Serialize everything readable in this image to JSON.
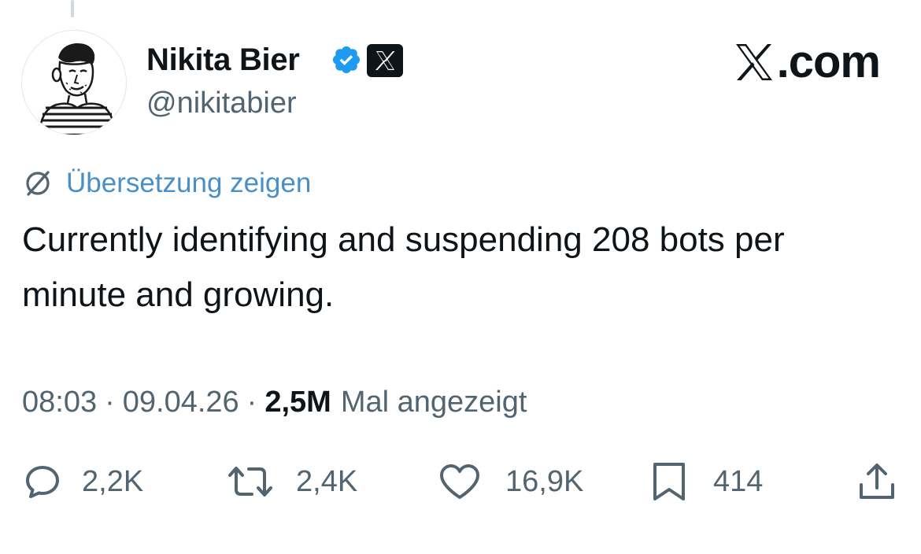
{
  "author": {
    "display_name": "Nikita Bier",
    "handle": "@nikitabier",
    "verified_icon": "verified-badge-icon",
    "affiliation_icon": "x-logo-icon"
  },
  "brand": {
    "text": ".com",
    "icon": "x-logo-icon"
  },
  "translate": {
    "label": "Übersetzung zeigen",
    "icon": "globe-translate-icon"
  },
  "tweet": {
    "text": "Currently identifying and suspending 208 bots per minute and growing."
  },
  "meta": {
    "time": "08:03",
    "separator": "·",
    "date": "09.04.26",
    "views_count": "2,5M",
    "views_label": "Mal angezeigt"
  },
  "actions": {
    "replies": {
      "count": "2,2K",
      "icon": "reply-icon"
    },
    "reposts": {
      "count": "2,4K",
      "icon": "repost-icon"
    },
    "likes": {
      "count": "16,9K",
      "icon": "heart-icon"
    },
    "bookmarks": {
      "count": "414",
      "icon": "bookmark-icon"
    },
    "share": {
      "icon": "share-icon"
    }
  },
  "colors": {
    "text_primary": "#0f1419",
    "text_secondary": "#536471",
    "verified_blue": "#1d9bf0",
    "link_blue": "#4a90c8"
  }
}
